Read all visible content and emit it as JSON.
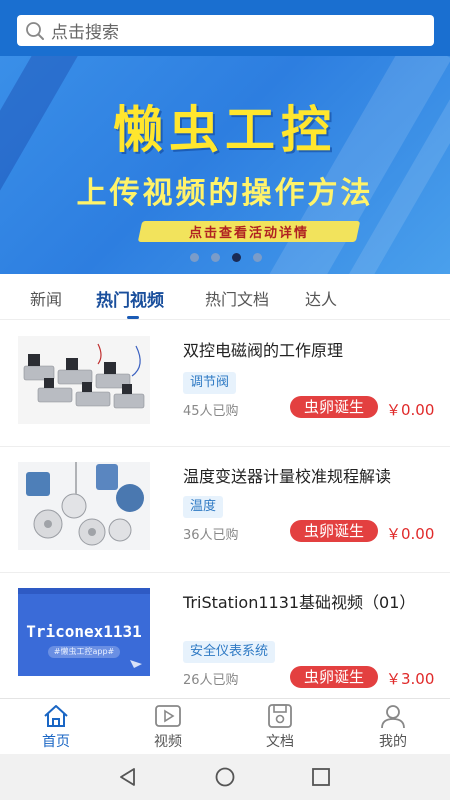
{
  "search": {
    "placeholder": "点击搜索"
  },
  "banner": {
    "title": "懒虫工控",
    "subtitle": "上传视频的操作方法",
    "cta": "点击查看活动详情",
    "dots": 4,
    "active_dot": 2
  },
  "tabs": [
    {
      "label": "新闻"
    },
    {
      "label": "热门视频"
    },
    {
      "label": "热门文档"
    },
    {
      "label": "达人"
    }
  ],
  "active_tab": 1,
  "videos": [
    {
      "title": "双控电磁阀的工作原理",
      "tag": "调节阀",
      "buyers": "45人已购",
      "badge": "虫卵诞生",
      "price": "￥0.00"
    },
    {
      "title": "温度变送器计量校准规程解读",
      "tag": "温度",
      "buyers": "36人已购",
      "badge": "虫卵诞生",
      "price": "￥0.00"
    },
    {
      "title": "TriStation1131基础视频（01）",
      "tag": "安全仪表系统",
      "buyers": "26人已购",
      "badge": "虫卵诞生",
      "price": "￥3.00",
      "thumb_text": "Triconex1131",
      "thumb_sub": "#懒虫工控app#"
    }
  ],
  "nav": [
    {
      "label": "首页",
      "icon": "home-icon"
    },
    {
      "label": "视频",
      "icon": "video-icon"
    },
    {
      "label": "文档",
      "icon": "document-icon"
    },
    {
      "label": "我的",
      "icon": "user-icon"
    }
  ],
  "active_nav": 0,
  "colors": {
    "accent": "#1a66c4",
    "badge": "#e34040",
    "price": "#e02a2a",
    "banner_title": "#ffe62e"
  }
}
